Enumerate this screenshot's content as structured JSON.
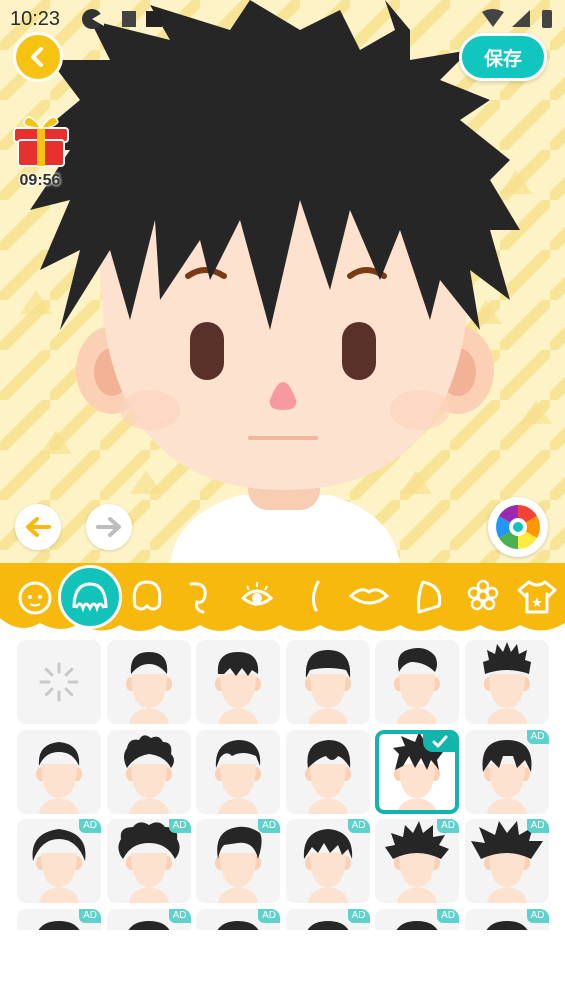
{
  "status_bar": {
    "time": "10:23"
  },
  "header": {
    "save_label": "保存",
    "timer": "09:56"
  },
  "colors": {
    "accent_teal": "#11c6be",
    "tab_yellow": "#f7b90e",
    "back_yellow": "#f7c313",
    "hair": "#262626",
    "skin": "#fde2cf"
  },
  "category_tabs": [
    {
      "icon": "face-icon"
    },
    {
      "icon": "hair-icon",
      "selected": true
    },
    {
      "icon": "back-hair-icon"
    },
    {
      "icon": "ear-icon"
    },
    {
      "icon": "eye-icon"
    },
    {
      "icon": "nose-icon"
    },
    {
      "icon": "mouth-icon"
    },
    {
      "icon": "blush-icon"
    },
    {
      "icon": "flower-accessory-icon"
    },
    {
      "icon": "shirt-icon"
    }
  ],
  "hair_options": [
    {
      "style": "none",
      "ad": false
    },
    {
      "style": "round",
      "ad": false
    },
    {
      "style": "bowl-fringe",
      "ad": false
    },
    {
      "style": "bowl",
      "ad": false
    },
    {
      "style": "quiff",
      "ad": false
    },
    {
      "style": "spiky-short",
      "ad": false
    },
    {
      "style": "flat-top",
      "ad": false
    },
    {
      "style": "curly-tuft",
      "ad": false
    },
    {
      "style": "side-part",
      "ad": false
    },
    {
      "style": "side-swoop",
      "ad": false
    },
    {
      "style": "messy",
      "ad": false,
      "selected": true
    },
    {
      "style": "long-fringe",
      "ad": true
    },
    {
      "style": "braids",
      "ad": true
    },
    {
      "style": "afro",
      "ad": true
    },
    {
      "style": "pompadour",
      "ad": true
    },
    {
      "style": "layered",
      "ad": true
    },
    {
      "style": "spiky",
      "ad": true
    },
    {
      "style": "wild-spiky",
      "ad": true
    },
    {
      "style": "row4-1",
      "ad": true
    },
    {
      "style": "row4-2",
      "ad": true
    },
    {
      "style": "row4-3",
      "ad": true
    },
    {
      "style": "row4-4",
      "ad": true
    },
    {
      "style": "row4-5",
      "ad": true
    },
    {
      "style": "row4-6",
      "ad": true
    }
  ],
  "ad_label": "AD"
}
